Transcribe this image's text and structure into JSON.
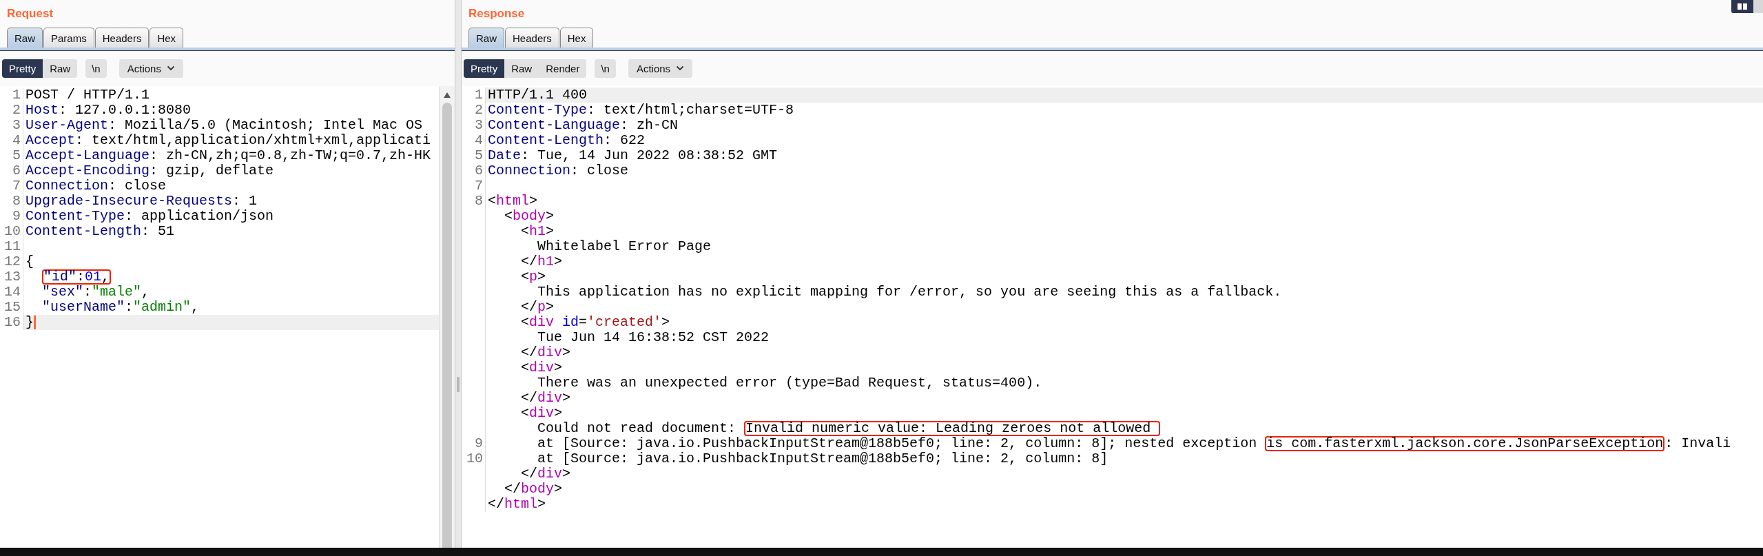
{
  "request": {
    "title": "Request",
    "tabs": [
      {
        "label": "Raw",
        "selected": true
      },
      {
        "label": "Params",
        "selected": false
      },
      {
        "label": "Headers",
        "selected": false
      },
      {
        "label": "Hex",
        "selected": false
      }
    ],
    "view_buttons": [
      {
        "label": "Pretty",
        "selected": true
      },
      {
        "label": "Raw",
        "selected": false
      }
    ],
    "newline_button": "\\n",
    "actions_button": "Actions",
    "rows": [
      {
        "number": "1",
        "current": false,
        "tokens": [
          {
            "kind": "plain",
            "text": "POST / HTTP/1.1"
          }
        ]
      },
      {
        "number": "2",
        "current": false,
        "tokens": [
          {
            "kind": "name",
            "text": "Host"
          },
          {
            "kind": "plain",
            "text": ": 127.0.0.1:8080"
          }
        ]
      },
      {
        "number": "3",
        "current": false,
        "tokens": [
          {
            "kind": "name",
            "text": "User-Agent"
          },
          {
            "kind": "plain",
            "text": ": Mozilla/5.0 (Macintosh; Intel Mac OS"
          }
        ]
      },
      {
        "number": "4",
        "current": false,
        "tokens": [
          {
            "kind": "name",
            "text": "Accept"
          },
          {
            "kind": "plain",
            "text": ": text/html,application/xhtml+xml,applicati"
          }
        ]
      },
      {
        "number": "5",
        "current": false,
        "tokens": [
          {
            "kind": "name",
            "text": "Accept-Language"
          },
          {
            "kind": "plain",
            "text": ": zh-CN,zh;q=0.8,zh-TW;q=0.7,zh-HK"
          }
        ]
      },
      {
        "number": "6",
        "current": false,
        "tokens": [
          {
            "kind": "name",
            "text": "Accept-Encoding"
          },
          {
            "kind": "plain",
            "text": ": gzip, deflate"
          }
        ]
      },
      {
        "number": "7",
        "current": false,
        "tokens": [
          {
            "kind": "name",
            "text": "Connection"
          },
          {
            "kind": "plain",
            "text": ": close"
          }
        ]
      },
      {
        "number": "8",
        "current": false,
        "tokens": [
          {
            "kind": "name",
            "text": "Upgrade-Insecure-Requests"
          },
          {
            "kind": "plain",
            "text": ": 1"
          }
        ]
      },
      {
        "number": "9",
        "current": false,
        "tokens": [
          {
            "kind": "name",
            "text": "Content-Type"
          },
          {
            "kind": "plain",
            "text": ": application/json"
          }
        ]
      },
      {
        "number": "10",
        "current": false,
        "tokens": [
          {
            "kind": "name",
            "text": "Content-Length"
          },
          {
            "kind": "plain",
            "text": ": 51"
          }
        ]
      },
      {
        "number": "11",
        "current": false
      },
      {
        "number": "12",
        "current": false,
        "tokens": [
          {
            "kind": "plain",
            "text": "{"
          }
        ]
      },
      {
        "number": "13",
        "current": false,
        "tokens": [
          {
            "kind": "box",
            "tokens": [
              {
                "kind": "name",
                "text": "  \"id\""
              },
              {
                "kind": "plain",
                "text": ":"
              },
              {
                "kind": "number",
                "text": "01"
              },
              {
                "kind": "plain",
                "text": ","
              }
            ]
          }
        ]
      },
      {
        "number": "14",
        "current": false,
        "tokens": [
          {
            "kind": "name",
            "text": "  \"sex\""
          },
          {
            "kind": "plain",
            "text": ":"
          },
          {
            "kind": "string",
            "text": "\"male\""
          },
          {
            "kind": "plain",
            "text": ","
          }
        ]
      },
      {
        "number": "15",
        "current": false,
        "tokens": [
          {
            "kind": "name",
            "text": "  \"userName\""
          },
          {
            "kind": "plain",
            "text": ":"
          },
          {
            "kind": "string",
            "text": "\"admin\""
          },
          {
            "kind": "plain",
            "text": ","
          }
        ]
      },
      {
        "number": "16",
        "current": true,
        "caret": true,
        "tokens": [
          {
            "kind": "plain",
            "text": "}"
          }
        ]
      }
    ]
  },
  "response": {
    "title": "Response",
    "tabs": [
      {
        "label": "Raw",
        "selected": true
      },
      {
        "label": "Headers",
        "selected": false
      },
      {
        "label": "Hex",
        "selected": false
      }
    ],
    "view_buttons": [
      {
        "label": "Pretty",
        "selected": true
      },
      {
        "label": "Raw",
        "selected": false
      },
      {
        "label": "Render",
        "selected": false
      }
    ],
    "newline_button": "\\n",
    "actions_button": "Actions",
    "rows": [
      {
        "number": "1",
        "current": true,
        "tokens": [
          {
            "kind": "plain",
            "text": "HTTP/1.1 400"
          }
        ]
      },
      {
        "number": "2",
        "current": false,
        "tokens": [
          {
            "kind": "name",
            "text": "Content-Type"
          },
          {
            "kind": "plain",
            "text": ": text/html;charset=UTF-8"
          }
        ]
      },
      {
        "number": "3",
        "current": false,
        "tokens": [
          {
            "kind": "name",
            "text": "Content-Language"
          },
          {
            "kind": "plain",
            "text": ": zh-CN"
          }
        ]
      },
      {
        "number": "4",
        "current": false,
        "tokens": [
          {
            "kind": "name",
            "text": "Content-Length"
          },
          {
            "kind": "plain",
            "text": ": 622"
          }
        ]
      },
      {
        "number": "5",
        "current": false,
        "tokens": [
          {
            "kind": "name",
            "text": "Date"
          },
          {
            "kind": "plain",
            "text": ": Tue, 14 Jun 2022 08:38:52 GMT"
          }
        ]
      },
      {
        "number": "6",
        "current": false,
        "tokens": [
          {
            "kind": "name",
            "text": "Connection"
          },
          {
            "kind": "plain",
            "text": ": close"
          }
        ]
      },
      {
        "number": "7",
        "current": false
      },
      {
        "number": "8",
        "current": false,
        "tokens": [
          {
            "kind": "plain",
            "text": "<"
          },
          {
            "kind": "tag",
            "text": "html"
          },
          {
            "kind": "plain",
            "text": ">"
          }
        ]
      },
      {
        "current": false,
        "tokens": [
          {
            "kind": "plain",
            "text": "  <"
          },
          {
            "kind": "tag",
            "text": "body"
          },
          {
            "kind": "plain",
            "text": ">"
          }
        ]
      },
      {
        "current": false,
        "tokens": [
          {
            "kind": "plain",
            "text": "    <"
          },
          {
            "kind": "tag",
            "text": "h1"
          },
          {
            "kind": "plain",
            "text": ">"
          }
        ]
      },
      {
        "current": false,
        "tokens": [
          {
            "kind": "plain",
            "text": "      Whitelabel Error Page"
          }
        ]
      },
      {
        "current": false,
        "tokens": [
          {
            "kind": "plain",
            "text": "    </"
          },
          {
            "kind": "tag",
            "text": "h1"
          },
          {
            "kind": "plain",
            "text": ">"
          }
        ]
      },
      {
        "current": false,
        "tokens": [
          {
            "kind": "plain",
            "text": "    <"
          },
          {
            "kind": "tag",
            "text": "p"
          },
          {
            "kind": "plain",
            "text": ">"
          }
        ]
      },
      {
        "current": false,
        "tokens": [
          {
            "kind": "plain",
            "text": "      This application has no explicit mapping for /error, so you are seeing this as a fallback."
          }
        ]
      },
      {
        "current": false,
        "tokens": [
          {
            "kind": "plain",
            "text": "    </"
          },
          {
            "kind": "tag",
            "text": "p"
          },
          {
            "kind": "plain",
            "text": ">"
          }
        ]
      },
      {
        "current": false,
        "tokens": [
          {
            "kind": "plain",
            "text": "    <"
          },
          {
            "kind": "tag",
            "text": "div"
          },
          {
            "kind": "attr",
            "text": " id"
          },
          {
            "kind": "plain",
            "text": "="
          },
          {
            "kind": "value",
            "text": "'created'"
          },
          {
            "kind": "plain",
            "text": ">"
          }
        ]
      },
      {
        "current": false,
        "tokens": [
          {
            "kind": "plain",
            "text": "      Tue Jun 14 16:38:52 CST 2022"
          }
        ]
      },
      {
        "current": false,
        "tokens": [
          {
            "kind": "plain",
            "text": "    </"
          },
          {
            "kind": "tag",
            "text": "div"
          },
          {
            "kind": "plain",
            "text": ">"
          }
        ]
      },
      {
        "current": false,
        "tokens": [
          {
            "kind": "plain",
            "text": "    <"
          },
          {
            "kind": "tag",
            "text": "div"
          },
          {
            "kind": "plain",
            "text": ">"
          }
        ]
      },
      {
        "current": false,
        "tokens": [
          {
            "kind": "plain",
            "text": "      There was an unexpected error (type=Bad Request, status=400)."
          }
        ]
      },
      {
        "current": false,
        "tokens": [
          {
            "kind": "plain",
            "text": "    </"
          },
          {
            "kind": "tag",
            "text": "div"
          },
          {
            "kind": "plain",
            "text": ">"
          }
        ]
      },
      {
        "current": false,
        "tokens": [
          {
            "kind": "plain",
            "text": "    <"
          },
          {
            "kind": "tag",
            "text": "div"
          },
          {
            "kind": "plain",
            "text": ">"
          }
        ]
      },
      {
        "current": false,
        "tokens": [
          {
            "kind": "plain",
            "text": "      Could not read document: "
          },
          {
            "kind": "box",
            "tokens": [
              {
                "kind": "plain",
                "text": "Invalid numeric value: Leading zeroes not allowed "
              }
            ]
          }
        ]
      },
      {
        "number": "9",
        "current": false,
        "tokens": [
          {
            "kind": "plain",
            "text": "      at [Source: java.io.PushbackInputStream@188b5ef0; line: 2, column: 8]; nested exception "
          },
          {
            "kind": "box",
            "tokens": [
              {
                "kind": "plain",
                "text": "is com.fasterxml.jackson.core.JsonParseException"
              }
            ]
          },
          {
            "kind": "plain",
            "text": ": Invali"
          }
        ]
      },
      {
        "number": "10",
        "current": false,
        "tokens": [
          {
            "kind": "plain",
            "text": "      at [Source: java.io.PushbackInputStream@188b5ef0; line: 2, column: 8]"
          }
        ]
      },
      {
        "current": false,
        "tokens": [
          {
            "kind": "plain",
            "text": "    </"
          },
          {
            "kind": "tag",
            "text": "div"
          },
          {
            "kind": "plain",
            "text": ">"
          }
        ]
      },
      {
        "current": false,
        "tokens": [
          {
            "kind": "plain",
            "text": "  </"
          },
          {
            "kind": "tag",
            "text": "body"
          },
          {
            "kind": "plain",
            "text": ">"
          }
        ]
      },
      {
        "current": false,
        "tokens": [
          {
            "kind": "plain",
            "text": "</"
          },
          {
            "kind": "tag",
            "text": "html"
          },
          {
            "kind": "plain",
            "text": ">"
          }
        ]
      }
    ]
  }
}
